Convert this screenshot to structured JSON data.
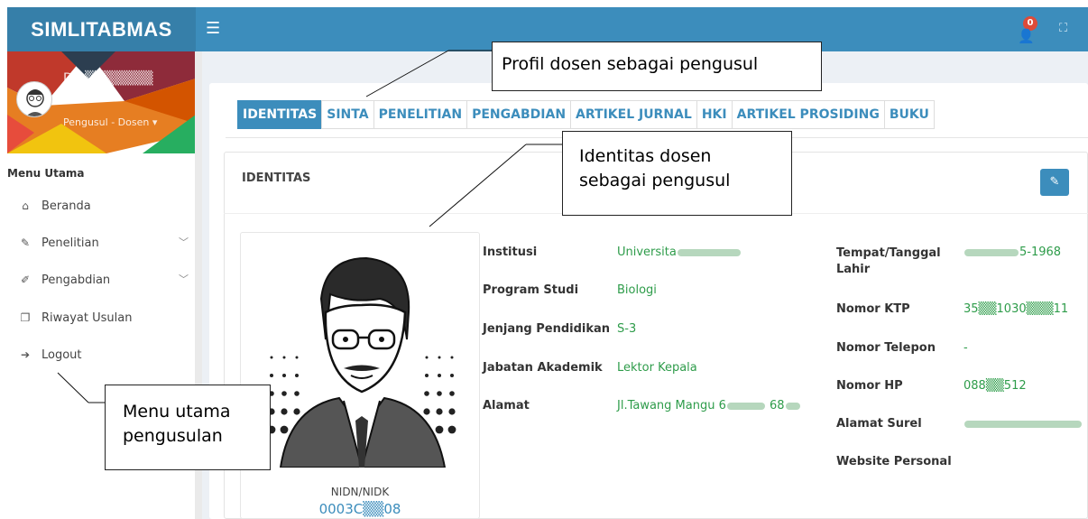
{
  "app": {
    "title": "SIMLITABMAS"
  },
  "header": {
    "menu_icon": "hamburger-icon",
    "notification_count": "0",
    "notification_icon": "user-plus-icon",
    "fullscreen_icon": "expand-icon"
  },
  "sidebar": {
    "user_name": "Dr. ▒▒▒▒▒▒▒",
    "user_role": "Pengusul - Dosen ▾",
    "menu_header": "Menu Utama",
    "items": [
      {
        "label": "Beranda",
        "icon": "home-icon",
        "glyph": "⌂"
      },
      {
        "label": "Penelitian",
        "icon": "edit-icon",
        "glyph": "✎"
      },
      {
        "label": "Pengabdian",
        "icon": "pencil-icon",
        "glyph": "✐"
      },
      {
        "label": "Riwayat Usulan",
        "icon": "history-icon",
        "glyph": "❐"
      },
      {
        "label": "Logout",
        "icon": "logout-icon",
        "glyph": "➔"
      }
    ]
  },
  "tabs": [
    {
      "label": "IDENTITAS",
      "active": true
    },
    {
      "label": "SINTA"
    },
    {
      "label": "PENELITIAN"
    },
    {
      "label": "PENGABDIAN"
    },
    {
      "label": "ARTIKEL JURNAL"
    },
    {
      "label": "HKI"
    },
    {
      "label": "ARTIKEL PROSIDING"
    },
    {
      "label": "BUKU"
    }
  ],
  "panel": {
    "title": "IDENTITAS",
    "edit_icon": "edit-icon"
  },
  "profile": {
    "nidn_label": "NIDN/NIDK",
    "nidn_value": "0003C▒▒08"
  },
  "identity_left": [
    {
      "label": "Institusi",
      "value": "Universita"
    },
    {
      "label": "Program Studi",
      "value": "Biologi"
    },
    {
      "label": "Jenjang Pendidikan",
      "value": "S-3"
    },
    {
      "label": "Jabatan Akademik",
      "value": "Lektor Kepala"
    },
    {
      "label": "Alamat",
      "value": "Jl.Tawang Mangu 6"
    }
  ],
  "identity_right": [
    {
      "label": "Tempat/Tanggal Lahir",
      "value": "5-1968"
    },
    {
      "label": "Nomor KTP",
      "value": "35▒▒1030▒▒▒11"
    },
    {
      "label": "Nomor Telepon",
      "value": "-"
    },
    {
      "label": "Nomor HP",
      "value": "088▒▒512"
    },
    {
      "label": "Alamat Surel",
      "value": ""
    },
    {
      "label": "Website Personal",
      "value": ""
    }
  ],
  "annotations": {
    "profil": "Profil dosen sebagai pengusul",
    "identitas_line1": "Identitas dosen",
    "identitas_line2": "sebagai pengusul",
    "menu_line1": "Menu utama",
    "menu_line2": "pengusulan"
  }
}
